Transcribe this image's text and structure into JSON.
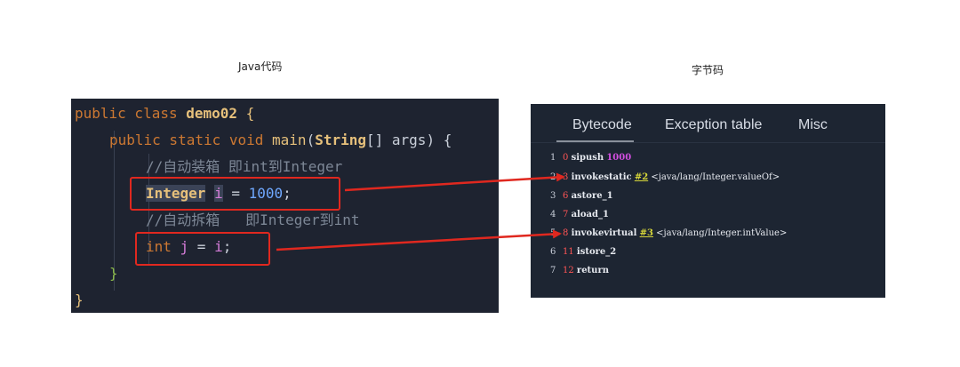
{
  "captions": {
    "java": "Java代码",
    "bytecode": "字节码"
  },
  "code": {
    "l1": {
      "kw": "public class ",
      "cls": "demo02",
      "brace": " {"
    },
    "l2": {
      "kw": "public static void ",
      "fn": "main",
      "paren_open": "(",
      "type": "String",
      "brackets": "[] ",
      "param": "args",
      "paren_close": ") {"
    },
    "l3": {
      "comment": "//自动装箱 即int到Integer"
    },
    "l4": {
      "type": "Integer",
      "var": "i",
      "eq": " = ",
      "num": "1000",
      "semi": ";"
    },
    "l5": {
      "comment": "//自动拆箱   即Integer到int"
    },
    "l6": {
      "kw": "int ",
      "var": "j",
      "eq": " = ",
      "rhs": "i",
      "semi": ";"
    },
    "l7": {
      "brace": "}"
    },
    "l8": {
      "brace": "}"
    }
  },
  "bytecode": {
    "tabs": [
      "Bytecode",
      "Exception table",
      "Misc"
    ],
    "lines": [
      {
        "n": "1",
        "off": "0",
        "op": "sipush",
        "arg": "1000"
      },
      {
        "n": "2",
        "off": "3",
        "op": "invokestatic",
        "ref": "#2",
        "comment": "<java/lang/Integer.valueOf>"
      },
      {
        "n": "3",
        "off": "6",
        "op": "astore_1"
      },
      {
        "n": "4",
        "off": "7",
        "op": "aload_1"
      },
      {
        "n": "5",
        "off": "8",
        "op": "invokevirtual",
        "ref": "#3",
        "comment": "<java/lang/Integer.intValue>"
      },
      {
        "n": "6",
        "off": "11",
        "op": "istore_2"
      },
      {
        "n": "7",
        "off": "12",
        "op": "return"
      }
    ]
  },
  "colors": {
    "annotation_red": "#e0281f",
    "code_bg": "#1e2330",
    "bytecode_bg": "#1d2532"
  }
}
